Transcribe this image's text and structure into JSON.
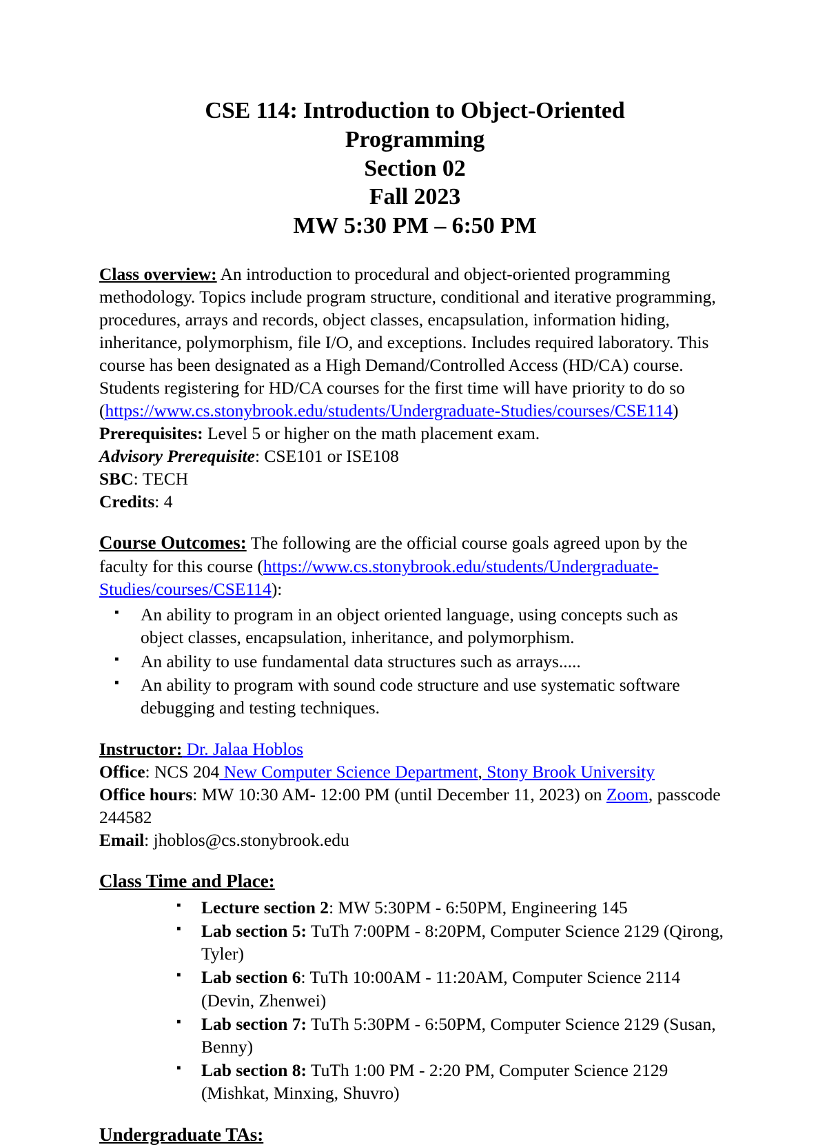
{
  "document": {
    "type": "course-syllabus",
    "link_color": "#0000ff",
    "text_color": "#000000",
    "background_color": "#ffffff"
  },
  "title": {
    "line1": "CSE 114: Introduction to Object-Oriented",
    "line2": "Programming",
    "line3": "Section 02",
    "line4": "Fall 2023",
    "line5": "MW 5:30 PM – 6:50 PM"
  },
  "class_overview": {
    "heading": "Class overview:",
    "text": " An introduction to procedural and object-oriented programming methodology. Topics include program structure, conditional and iterative programming, procedures, arrays and records, object classes, encapsulation, information hiding, inheritance, polymorphism, file I/O, and exceptions. Includes required laboratory. This course has been designated as a High Demand/Controlled Access (HD/CA) course. Students registering for HD/CA courses for the first time will have priority to do so (",
    "link": "https://www.cs.stonybrook.edu/students/Undergraduate-Studies/courses/CSE114",
    "text_after_link": ")"
  },
  "details": {
    "prerequisites_label": "Prerequisites:",
    "prerequisites_value": " Level 5 or higher on the math placement exam.",
    "advisory_label": "Advisory Prerequisite",
    "advisory_value": ": CSE101 or ISE108",
    "sbc_label": "SBC",
    "sbc_value": ": TECH",
    "credits_label": "Credits",
    "credits_value": ": 4"
  },
  "course_outcomes": {
    "heading": "Course Outcomes:",
    "intro": " The following are the official course goals agreed upon by the faculty for this course (",
    "link": "https://www.cs.stonybrook.edu/students/Undergraduate-Studies/courses/CSE114",
    "intro_after_link": "):",
    "items": [
      "An ability to program in an object oriented language, using concepts such as object classes, encapsulation, inheritance, and polymorphism.",
      "An ability to use fundamental data structures such as arrays.....",
      "An ability to program with sound code structure and use systematic software debugging and testing techniques."
    ]
  },
  "instructor": {
    "instructor_label": "Instructor:",
    "instructor_name": " Dr. Jalaa Hoblos",
    "office_label": "Office",
    "office_value": ": NCS 204",
    "office_link_1": " New Computer Science Department",
    "office_separator": ",",
    "office_link_2": " Stony Brook University",
    "office_hours_label": "Office hours",
    "office_hours_value": ": MW 10:30 AM- 12:00 PM (until December 11, 2023) on ",
    "office_hours_link": "Zoom",
    "office_hours_passcode": ", passcode 244582",
    "email_label": "Email",
    "email_value": ": jhoblos@cs.stonybrook.edu"
  },
  "class_time": {
    "heading": "Class Time and Place:",
    "items": [
      {
        "bold": "Lecture section 2",
        "rest": ": MW 5:30PM - 6:50PM, Engineering 145"
      },
      {
        "bold": "Lab section 5:",
        "rest": " TuTh 7:00PM - 8:20PM, Computer Science 2129 (Qirong, Tyler)"
      },
      {
        "bold": "Lab section 6",
        "rest": ": TuTh 10:00AM - 11:20AM, Computer Science 2114 (Devin, Zhenwei)"
      },
      {
        "bold": "Lab section 7:",
        "rest": " TuTh 5:30PM - 6:50PM, Computer Science 2129 (Susan, Benny)"
      },
      {
        "bold": "Lab section 8:",
        "rest": " TuTh 1:00 PM - 2:20 PM, Computer Science 2129 (Mishkat, Minxing, Shuvro)"
      }
    ]
  },
  "undergraduate_tas": {
    "heading": "Undergraduate TAs:"
  }
}
